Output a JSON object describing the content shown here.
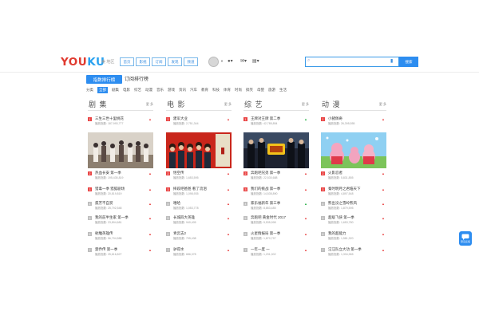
{
  "header": {
    "logo_part1": "YOU",
    "logo_part2": "KU",
    "region": "美 地区",
    "nav": [
      "首页",
      "影视",
      "订阅",
      "发现",
      "频道"
    ],
    "search_button": "搜索"
  },
  "tabs": {
    "active": "指数排行榜",
    "other": "订阅排行榜"
  },
  "filters": [
    "分类",
    "全部",
    "剧集",
    "电影",
    "综艺",
    "动漫",
    "音乐",
    "游戏",
    "资讯",
    "汽车",
    "教育",
    "科技",
    "体育",
    "时尚",
    "搞笑",
    "母婴",
    "旅游",
    "生活"
  ],
  "filters_active_index": 1,
  "columns": [
    {
      "title": "剧 集",
      "more": "更 多",
      "items": [
        {
          "rank": "1",
          "name": "三生三世十里桃花",
          "visits": "播放指数: 187,993,777",
          "trend": "up"
        },
        {
          "rank": "2",
          "name": "热血长安 第一季",
          "visits": "播放指数: 195,435,819",
          "trend": "up"
        },
        {
          "rank": "3",
          "name": "猎毒一季 猎狐剧场",
          "visits": "播放指数: 20,819,819",
          "trend": "up"
        },
        {
          "rank": "4",
          "name": "孤芳不自赏",
          "visits": "播放指数: 25,792,548",
          "trend": "up"
        },
        {
          "rank": "5",
          "name": "我的前半生家 第一季",
          "visits": "播放指数: 23,894,681",
          "trend": "up"
        },
        {
          "rank": "6",
          "name": "射雕英雄传",
          "visits": "播放指数: 56,794,588",
          "trend": "up"
        },
        {
          "rank": "7",
          "name": "楚乔传 第一季",
          "visits": "播放指数: 25,616,827",
          "trend": "up"
        }
      ]
    },
    {
      "title": "电 影",
      "more": "更 多",
      "items": [
        {
          "rank": "1",
          "name": "建军大业",
          "visits": "播放指数: 2,751,344",
          "trend": "up"
        },
        {
          "rank": "2",
          "name": "悟空传",
          "visits": "播放指数: 1,653,595",
          "trend": "up"
        },
        {
          "rank": "3",
          "name": "摔跤吧爸爸 看了流泪",
          "visits": "播放指数: 1,098,935",
          "trend": "up"
        },
        {
          "rank": "4",
          "name": "嘻哈",
          "visits": "播放指数: 1,053,778",
          "trend": "up"
        },
        {
          "rank": "5",
          "name": "长城四大英雄",
          "visits": "播放指数: 940,405",
          "trend": "up"
        },
        {
          "rank": "6",
          "name": "青云志2",
          "visits": "播放指数: 795,438",
          "trend": "up"
        },
        {
          "rank": "7",
          "name": "驴得水",
          "visits": "播放指数: 686,378",
          "trend": "up"
        }
      ]
    },
    {
      "title": "综 艺",
      "more": "更 多",
      "items": [
        {
          "rank": "1",
          "name": "王牌对王牌 第二季",
          "visits": "播放指数: 42,785,854",
          "trend": "up-green"
        },
        {
          "rank": "2",
          "name": "奔跑吧兄弟 第一季",
          "visits": "播放指数: 22,530,688",
          "trend": "up"
        },
        {
          "rank": "3",
          "name": "我们的挑战 第一季",
          "visits": "播放指数: 14,535,890",
          "trend": "up"
        },
        {
          "rank": "4",
          "name": "家乐福新年 第三季",
          "visits": "播放指数: 8,853,485",
          "trend": "up-green"
        },
        {
          "rank": "5",
          "name": "奔跑吧 黄金时代 2017",
          "visits": "播放指数: 5,535,998",
          "trend": "up"
        },
        {
          "rank": "6",
          "name": "火星情报局 第一季",
          "visits": "播放指数: 1,870,797",
          "trend": "up"
        },
        {
          "rank": "7",
          "name": "一年一度 一",
          "visits": "播放指数: 1,231,002",
          "trend": "up"
        }
      ]
    },
    {
      "title": "动 漫",
      "more": "更 多",
      "items": [
        {
          "rank": "1",
          "name": "小猪佩奇",
          "visits": "播放指数: 26,395,555",
          "trend": "up"
        },
        {
          "rank": "2",
          "name": "火影忍者",
          "visits": "播放指数: 5,831,855",
          "trend": "up"
        },
        {
          "rank": "3",
          "name": "秦时明月之君临天下",
          "visits": "播放指数: 4,897,548",
          "trend": "up"
        },
        {
          "rank": "4",
          "name": "熊出没之雪岭熊风",
          "visits": "播放指数: 1,879,595",
          "trend": "up"
        },
        {
          "rank": "5",
          "name": "超级飞侠 第一季",
          "visits": "播放指数: 1,653,780",
          "trend": "up"
        },
        {
          "rank": "6",
          "name": "我的超能力",
          "visits": "播放指数: 1,581,320",
          "trend": "up"
        },
        {
          "rank": "7",
          "name": "汪汪队立大功 第一季",
          "visits": "播放指数: 1,334,965",
          "trend": "up"
        }
      ]
    }
  ],
  "float_button": "意见反馈",
  "colors": {
    "accent": "#2d8df0",
    "rank_top": "#e94444",
    "rank_other": "#bdbdbd",
    "logo_red": "#e03a2f",
    "logo_blue": "#2aa2f0"
  }
}
